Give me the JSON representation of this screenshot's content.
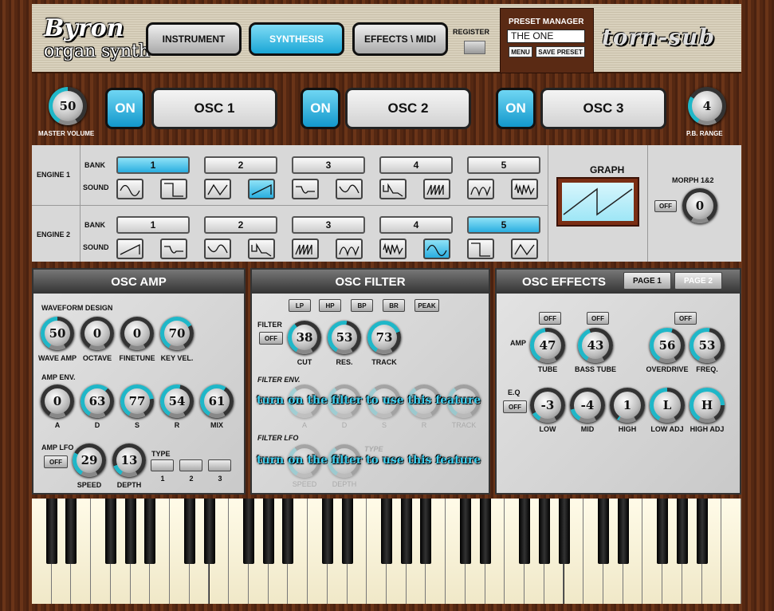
{
  "header": {
    "logo_top": "Byron",
    "logo_bottom": "organ synth",
    "tabs": [
      {
        "label": "INSTRUMENT"
      },
      {
        "label": "SYNTHESIS"
      },
      {
        "label": "EFFECTS \\ MIDI"
      }
    ],
    "register_label": "REGISTER",
    "brand": "torn-sub"
  },
  "preset": {
    "title": "PRESET MANAGER",
    "value": "THE ONE",
    "menu": "MENU",
    "save": "SAVE PRESET"
  },
  "osc_row": {
    "master_volume": {
      "value": "50",
      "label": "MASTER VOLUME",
      "arc": 0.5
    },
    "pb_range": {
      "value": "4",
      "label": "P.B. RANGE",
      "arc": 0.3
    },
    "oscs": [
      {
        "on": "ON",
        "label": "OSC 1",
        "selected": true
      },
      {
        "on": "ON",
        "label": "OSC 2",
        "selected": false
      },
      {
        "on": "ON",
        "label": "OSC 3",
        "selected": false
      }
    ]
  },
  "engines": [
    {
      "label": "ENGINE 1",
      "bank_label": "BANK",
      "sound_label": "SOUND",
      "banks": [
        "1",
        "2",
        "3",
        "4",
        "5"
      ],
      "selected_bank": 0,
      "selected_sound": 3
    },
    {
      "label": "ENGINE 2",
      "bank_label": "BANK",
      "sound_label": "SOUND",
      "banks": [
        "1",
        "2",
        "3",
        "4",
        "5"
      ],
      "selected_bank": 4,
      "selected_sound": 7
    }
  ],
  "graph": {
    "title": "GRAPH"
  },
  "morph": {
    "label": "MORPH 1&2",
    "off": "OFF",
    "value": "0",
    "arc": 0
  },
  "osc_amp": {
    "title": "OSC AMP",
    "waveform_title": "WAVEFORM DESIGN",
    "env_title": "AMP ENV.",
    "lfo_title": "AMP LFO",
    "lfo_off": "OFF",
    "type_label": "TYPE",
    "types": [
      "1",
      "2",
      "3"
    ],
    "selected_type": 0,
    "waveform": [
      {
        "value": "50",
        "label": "WAVE AMP",
        "arc": 0.5
      },
      {
        "value": "0",
        "label": "OCTAVE",
        "arc": 0
      },
      {
        "value": "0",
        "label": "FINETUNE",
        "arc": 0
      },
      {
        "value": "70",
        "label": "KEY VEL.",
        "arc": 0.7
      }
    ],
    "env": [
      {
        "value": "0",
        "label": "A",
        "arc": 0
      },
      {
        "value": "63",
        "label": "D",
        "arc": 0.63
      },
      {
        "value": "77",
        "label": "S",
        "arc": 0.77
      },
      {
        "value": "54",
        "label": "R",
        "arc": 0.54
      },
      {
        "value": "61",
        "label": "MIX",
        "arc": 0.61
      }
    ],
    "lfo": [
      {
        "value": "29",
        "label": "SPEED",
        "arc": 0.29
      },
      {
        "value": "13",
        "label": "DEPTH",
        "arc": 0.13
      }
    ]
  },
  "osc_filter": {
    "title": "OSC FILTER",
    "types": [
      "LP",
      "HP",
      "BP",
      "BR",
      "PEAK"
    ],
    "selected_type": 0,
    "filter_label": "FILTER",
    "off": "OFF",
    "knobs": [
      {
        "value": "38",
        "label": "CUT",
        "arc": 0.38
      },
      {
        "value": "53",
        "label": "RES.",
        "arc": 0.53
      },
      {
        "value": "73",
        "label": "TRACK",
        "arc": 0.73
      }
    ],
    "env_title": "FILTER ENV.",
    "env_labels": [
      "A",
      "D",
      "S",
      "R",
      "TRACK"
    ],
    "lfo_title": "FILTER LFO",
    "lfo_labels": [
      "SPEED",
      "DEPTH"
    ],
    "lfo_type": "TYPE",
    "notice": "turn on the filter to use this feature"
  },
  "osc_effects": {
    "title": "OSC EFFECTS",
    "pages": [
      "PAGE 1",
      "PAGE 2"
    ],
    "selected_page": 1,
    "amp_label": "AMP",
    "eq_label": "E.Q",
    "off": "OFF",
    "amp": [
      {
        "value": "47",
        "label": "TUBE",
        "arc": 0.47
      },
      {
        "value": "43",
        "label": "BASS TUBE",
        "arc": 0.43
      },
      {
        "value": "56",
        "label": "OVERDRIVE",
        "arc": 0.56
      },
      {
        "value": "53",
        "label": "FREQ.",
        "arc": 0.53
      }
    ],
    "eq": [
      {
        "value": "-3",
        "label": "LOW",
        "arc": 0.1
      },
      {
        "value": "-4",
        "label": "MID",
        "arc": 0.15
      },
      {
        "value": "1",
        "label": "HIGH",
        "arc": 0.02
      },
      {
        "value": "L",
        "label": "LOW ADJ",
        "arc": 0.5
      },
      {
        "value": "H",
        "label": "HIGH ADJ",
        "arc": 0.8
      }
    ]
  },
  "colors": {
    "accent": "#1aa6d6",
    "wood": "#5a2c14"
  }
}
